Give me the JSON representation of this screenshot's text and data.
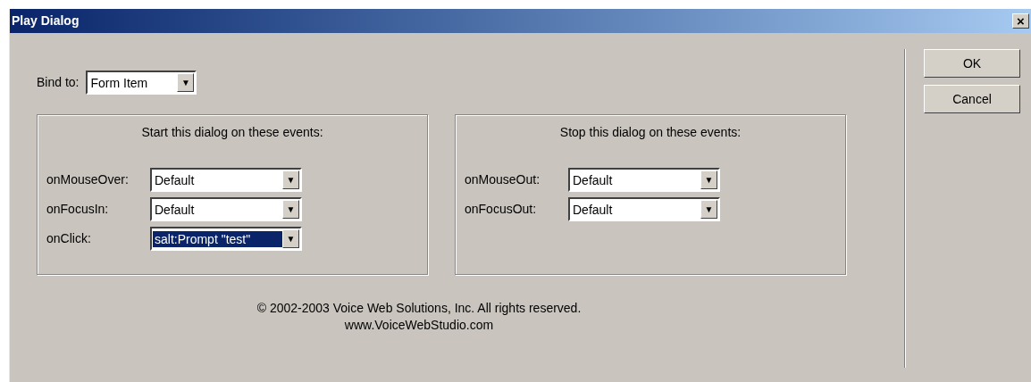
{
  "window": {
    "title": "Play Dialog",
    "close": "×"
  },
  "bind": {
    "label": "Bind to:",
    "value": "Form Item",
    "arrow": "▼"
  },
  "groups": [
    {
      "heading": "Start this dialog on these events:",
      "events": [
        {
          "label": "onMouseOver:",
          "value": "Default",
          "arrow": "▼",
          "focused": false
        },
        {
          "label": "onFocusIn:",
          "value": "Default",
          "arrow": "▼",
          "focused": false
        },
        {
          "label": "onClick:",
          "value": "salt:Prompt \"test\"",
          "arrow": "▼",
          "focused": true
        }
      ]
    },
    {
      "heading": "Stop this dialog on these events:",
      "events": [
        {
          "label": "onMouseOut:",
          "value": "Default",
          "arrow": "▼",
          "focused": false
        },
        {
          "label": "onFocusOut:",
          "value": "Default",
          "arrow": "▼",
          "focused": false
        }
      ]
    }
  ],
  "copyright": [
    "© 2002-2003 Voice Web Solutions, Inc. All rights reserved.",
    "www.VoiceWebStudio.com"
  ],
  "buttons": [
    "OK",
    "Cancel"
  ]
}
